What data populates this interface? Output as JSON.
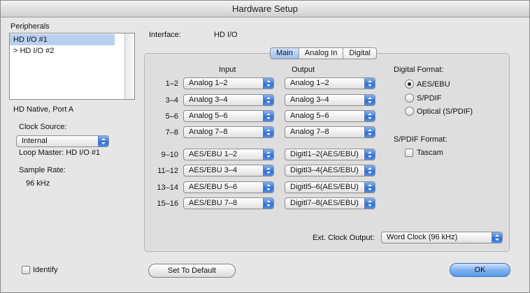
{
  "window": {
    "title": "Hardware Setup"
  },
  "peripherals": {
    "label": "Peripherals",
    "items": [
      {
        "label": "HD I/O #1",
        "selected": true
      },
      {
        "label": "> HD I/O #2",
        "selected": false
      }
    ]
  },
  "left": {
    "port_label": "HD Native, Port A",
    "clock_source_label": "Clock Source:",
    "clock_source_value": "Internal",
    "loop_master": "Loop Master: HD I/O #1",
    "sample_rate_label": "Sample Rate:",
    "sample_rate_value": "96 kHz"
  },
  "interface": {
    "label": "Interface:",
    "value": "HD I/O"
  },
  "tabs": [
    "Main",
    "Analog In",
    "Digital"
  ],
  "io": {
    "input_header": "Input",
    "output_header": "Output",
    "rows": [
      {
        "channel": "1–2",
        "input": "Analog 1–2",
        "output": "Analog 1–2"
      },
      {
        "channel": "3–4",
        "input": "Analog 3–4",
        "output": "Analog 3–4"
      },
      {
        "channel": "5–6",
        "input": "Analog 5–6",
        "output": "Analog 5–6"
      },
      {
        "channel": "7–8",
        "input": "Analog 7–8",
        "output": "Analog 7–8"
      },
      {
        "channel": "9–10",
        "input": "AES/EBU 1–2",
        "output": "Digitl1–2(AES/EBU)"
      },
      {
        "channel": "11–12",
        "input": "AES/EBU 3–4",
        "output": "Digitl3–4(AES/EBU)"
      },
      {
        "channel": "13–14",
        "input": "AES/EBU 5–6",
        "output": "Digitl5–6(AES/EBU)"
      },
      {
        "channel": "15–16",
        "input": "AES/EBU 7–8",
        "output": "Digitl7–8(AES/EBU)"
      }
    ]
  },
  "digital_format": {
    "label": "Digital Format:",
    "options": [
      {
        "label": "AES/EBU",
        "selected": true
      },
      {
        "label": "S/PDIF",
        "selected": false
      },
      {
        "label": "Optical (S/PDIF)",
        "selected": false
      }
    ]
  },
  "spdif_format": {
    "label": "S/PDIF Format:",
    "tascam_label": "Tascam"
  },
  "ext_clock": {
    "label": "Ext. Clock Output:",
    "value": "Word Clock (96 kHz)"
  },
  "footer": {
    "identify_label": "Identify",
    "set_default_label": "Set To Default",
    "ok_label": "OK"
  }
}
